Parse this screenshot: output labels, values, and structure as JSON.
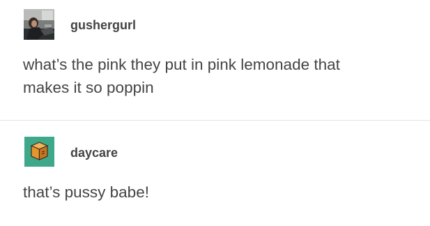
{
  "posts": [
    {
      "username": "gushergurl",
      "text_lines": [
        "what’s the pink they put in pink lemonade that",
        "makes it so poppin"
      ]
    },
    {
      "username": "daycare",
      "text_lines": [
        "that’s pussy babe!"
      ]
    }
  ],
  "colors": {
    "text": "#444444",
    "divider": "#e4e4e4",
    "avatar_daycare_bg": "#3fa88a",
    "avatar_daycare_box": "#e8952f"
  },
  "icons": {
    "avatar_1": "user-photo-avatar-icon",
    "avatar_2": "orange-box-avatar-icon"
  }
}
